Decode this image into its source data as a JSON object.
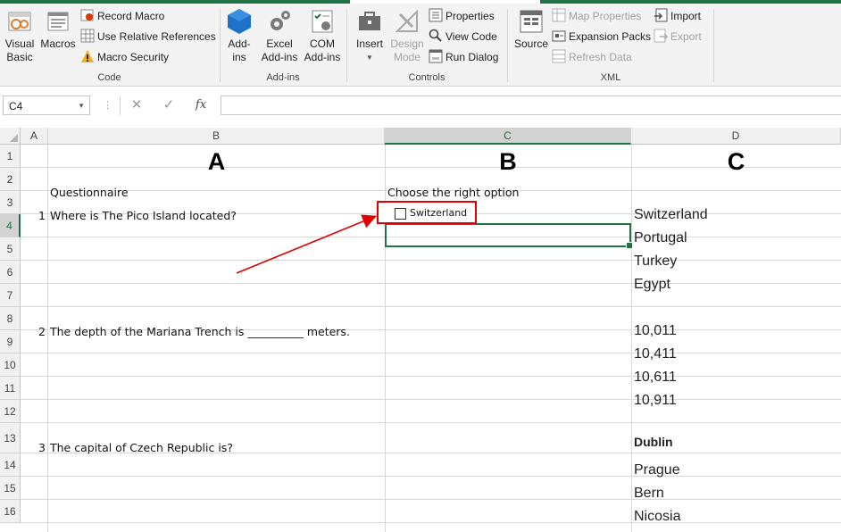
{
  "ribbon": {
    "code_group": {
      "label": "Code",
      "visual_basic": "Visual\nBasic",
      "visual_basic_l1": "Visual",
      "visual_basic_l2": "Basic",
      "macros": "Macros",
      "record_macro": "Record Macro",
      "use_relative_references": "Use Relative References",
      "macro_security": "Macro Security"
    },
    "addins_group": {
      "label": "Add-ins",
      "addins_l1": "Add-",
      "addins_l2": "ins",
      "excel_addins_l1": "Excel",
      "excel_addins_l2": "Add-ins",
      "com_addins_l1": "COM",
      "com_addins_l2": "Add-ins"
    },
    "controls_group": {
      "label": "Controls",
      "insert": "Insert",
      "design_mode_l1": "Design",
      "design_mode_l2": "Mode",
      "properties": "Properties",
      "view_code": "View Code",
      "run_dialog": "Run Dialog"
    },
    "xml_group": {
      "label": "XML",
      "source": "Source",
      "map_properties": "Map Properties",
      "expansion_packs": "Expansion Packs",
      "refresh_data": "Refresh Data",
      "import": "Import",
      "export": "Export"
    }
  },
  "formula_bar": {
    "name_box": "C4",
    "cancel_glyph": "✕",
    "enter_glyph": "✓",
    "fx_label": "fx",
    "formula": ""
  },
  "sheet": {
    "columns": [
      "A",
      "B",
      "C",
      "D"
    ],
    "rows": [
      "1",
      "2",
      "3",
      "4",
      "5",
      "6",
      "7",
      "8",
      "9",
      "10",
      "11",
      "12",
      "13",
      "14",
      "15",
      "16"
    ],
    "selected_column": "C",
    "selected_row": "4",
    "cells": {
      "B1": "A",
      "C1": "B",
      "D1": "C",
      "B2": "Questionnaire",
      "C2": "Choose the right option",
      "A3": "1",
      "B3": "Where is The Pico Island located?",
      "D3": "Switzerland",
      "D4": "Portugal",
      "D5": "Turkey",
      "D6": "Egypt",
      "A8": "2",
      "B8": "The depth of the Mariana Trench is __________ meters.",
      "D8": "10,011",
      "D9": "10,411",
      "D10": "10,611",
      "D11": "10,911",
      "A13": "3",
      "B13": "The capital of Czech Republic is?",
      "D13": "Dublin",
      "D14": "Prague",
      "D15": "Bern",
      "D16": "Nicosia"
    },
    "checkbox_control": {
      "label": "Switzerland",
      "checked": false
    }
  },
  "colors": {
    "accent": "#217346",
    "highlight_border": "#e00000",
    "arrow": "#e00000"
  }
}
